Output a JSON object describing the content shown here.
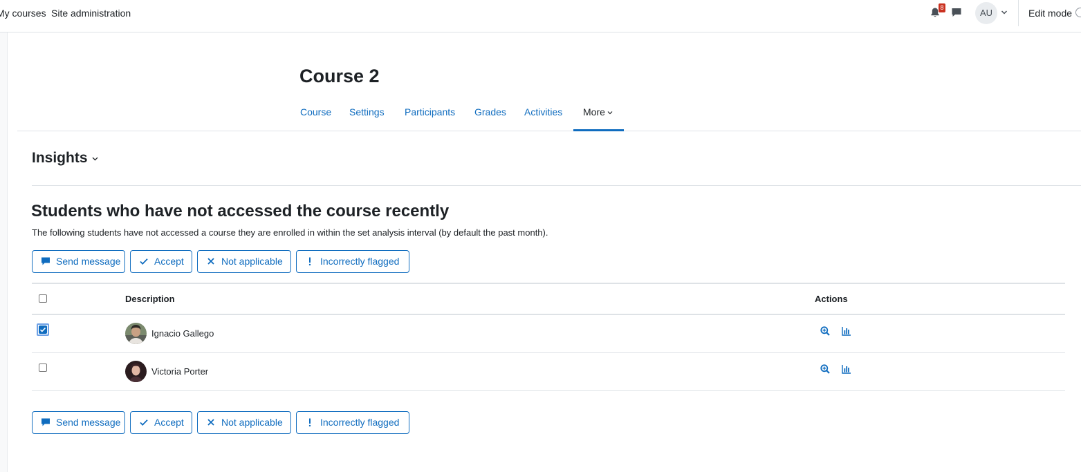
{
  "navbar": {
    "my_courses": "My courses",
    "site_admin": "Site administration",
    "notification_count": "8",
    "user_initials": "AU",
    "edit_mode": "Edit mode"
  },
  "course": {
    "title": "Course 2",
    "tabs": [
      {
        "label": "Course"
      },
      {
        "label": "Settings"
      },
      {
        "label": "Participants"
      },
      {
        "label": "Grades"
      },
      {
        "label": "Activities"
      },
      {
        "label": "More"
      }
    ],
    "active_tab": "More"
  },
  "insights": {
    "label": "Insights"
  },
  "analysis": {
    "heading": "Students who have not accessed the course recently",
    "description": "The following students have not accessed a course they are enrolled in within the set analysis interval (by default the past month)."
  },
  "buttons": {
    "send_message": "Send message",
    "accept": "Accept",
    "not_applicable": "Not applicable",
    "incorrectly_flagged": "Incorrectly flagged"
  },
  "table": {
    "headers": {
      "description": "Description",
      "actions": "Actions"
    },
    "rows": [
      {
        "name": "Ignacio Gallego",
        "checked": true
      },
      {
        "name": "Victoria Porter",
        "checked": false
      }
    ]
  },
  "colors": {
    "primary": "#0f6cbf",
    "badge": "#ca3120",
    "text": "#1d2125"
  },
  "icons": {
    "bell": "bell-icon",
    "chat": "comment-icon",
    "zoom": "search-plus-icon",
    "chart": "bar-chart-icon"
  }
}
